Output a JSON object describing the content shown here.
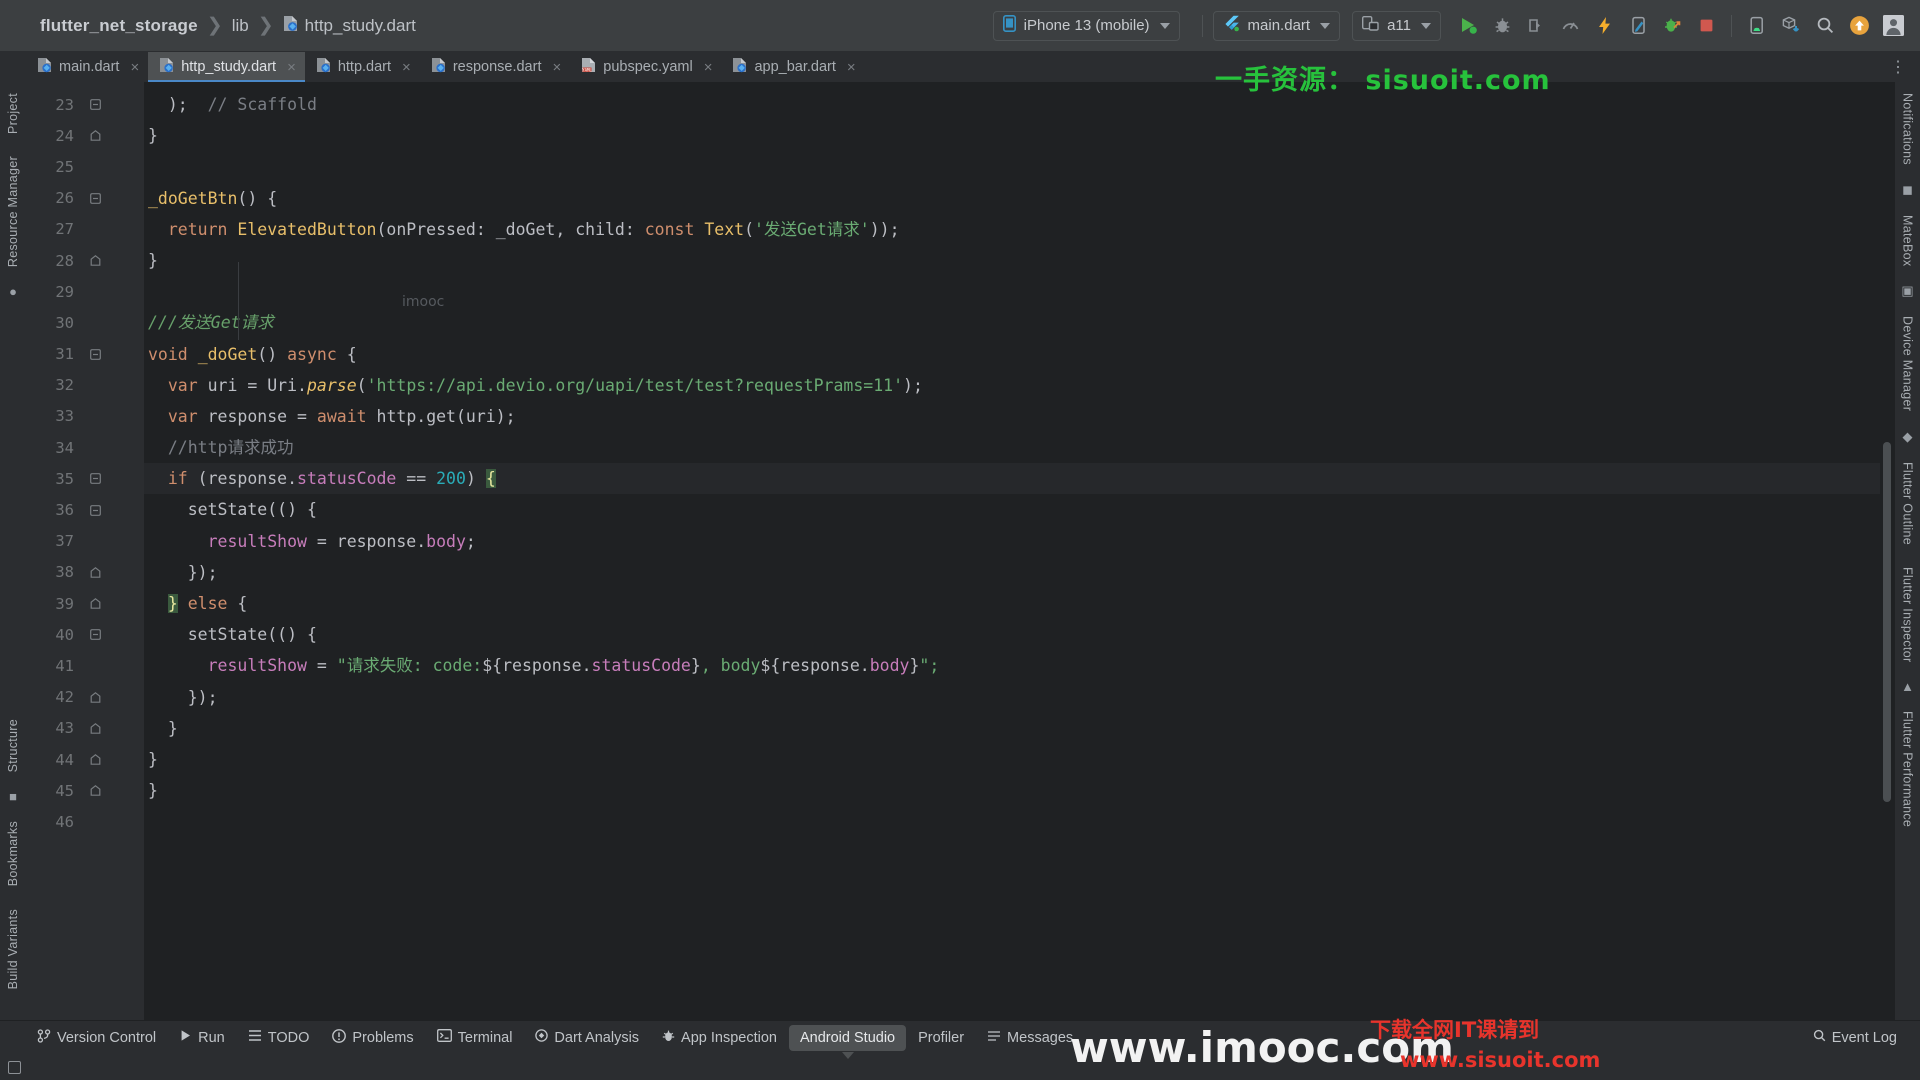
{
  "window": {
    "app": "Android Studio"
  },
  "breadcrumb": {
    "project": "flutter_net_storage",
    "folder": "lib",
    "file": "http_study.dart",
    "separator": "❯"
  },
  "toolbar": {
    "device_selector": "iPhone 13 (mobile)",
    "run_config": "main.dart",
    "emulator_target": "a11",
    "icons": [
      "run-icon",
      "debug-icon",
      "attach-debugger-icon",
      "profile-icon",
      "hot-reload-icon",
      "hot-restart-icon",
      "open-devtools-icon",
      "stop-icon"
    ],
    "right_icons": [
      "device-manager-icon",
      "sdk-download-icon",
      "search-icon",
      "update-icon",
      "avatar-icon"
    ]
  },
  "tabs": [
    {
      "label": "main.dart",
      "icon": "dart-file-icon",
      "active": false,
      "close": "×"
    },
    {
      "label": "http_study.dart",
      "icon": "dart-file-icon",
      "active": true,
      "close": "×"
    },
    {
      "label": "http.dart",
      "icon": "dart-file-icon",
      "active": false,
      "close": "×"
    },
    {
      "label": "response.dart",
      "icon": "dart-file-icon",
      "active": false,
      "close": "×"
    },
    {
      "label": "pubspec.yaml",
      "icon": "yaml-file-icon",
      "active": false,
      "close": "×"
    },
    {
      "label": "app_bar.dart",
      "icon": "dart-file-icon",
      "active": false,
      "close": "×"
    }
  ],
  "tabs_overflow_icon": "⋮",
  "left_tool_strip": [
    {
      "label": "Project",
      "name": "tool-project"
    },
    {
      "label": "Resource Manager",
      "name": "tool-resource-manager"
    },
    {
      "label": "Structure",
      "name": "tool-structure"
    },
    {
      "label": "Bookmarks",
      "name": "tool-bookmarks"
    },
    {
      "label": "Build Variants",
      "name": "tool-build-variants"
    }
  ],
  "right_tool_strip": [
    {
      "label": "Notifications",
      "name": "tool-notifications"
    },
    {
      "label": "MateBox",
      "name": "tool-matebox"
    },
    {
      "label": "Device Manager",
      "name": "tool-device-manager"
    },
    {
      "label": "Flutter Outline",
      "name": "tool-flutter-outline"
    },
    {
      "label": "Flutter Inspector",
      "name": "tool-flutter-inspector"
    },
    {
      "label": "Flutter Performance",
      "name": "tool-flutter-performance"
    }
  ],
  "editor": {
    "current_line": 35,
    "first_line": 23,
    "lines": [
      {
        "n": 23,
        "fold": "minus",
        "tokens": [
          {
            "t": "  );  ",
            "c": "punct"
          },
          {
            "t": "// Scaffold",
            "c": "cmt"
          }
        ]
      },
      {
        "n": 24,
        "fold": "end",
        "tokens": [
          {
            "t": "}",
            "c": "punct"
          }
        ]
      },
      {
        "n": 25,
        "fold": "",
        "tokens": [
          {
            "t": "",
            "c": "plain"
          }
        ]
      },
      {
        "n": 26,
        "fold": "minus",
        "tokens": [
          {
            "t": "_doGetBtn",
            "c": "fn"
          },
          {
            "t": "() {",
            "c": "punct"
          }
        ]
      },
      {
        "n": 27,
        "fold": "",
        "tokens": [
          {
            "t": "  ",
            "c": "plain"
          },
          {
            "t": "return",
            "c": "kw"
          },
          {
            "t": " ",
            "c": "plain"
          },
          {
            "t": "ElevatedButton",
            "c": "fn"
          },
          {
            "t": "(onPressed: ",
            "c": "punct"
          },
          {
            "t": "_doGet",
            "c": "plain"
          },
          {
            "t": ", child: ",
            "c": "punct"
          },
          {
            "t": "const",
            "c": "kw"
          },
          {
            "t": " ",
            "c": "plain"
          },
          {
            "t": "Text",
            "c": "fn"
          },
          {
            "t": "(",
            "c": "punct"
          },
          {
            "t": "'发送Get请求'",
            "c": "str"
          },
          {
            "t": "));",
            "c": "punct"
          }
        ]
      },
      {
        "n": 28,
        "fold": "end",
        "tokens": [
          {
            "t": "}",
            "c": "punct"
          }
        ]
      },
      {
        "n": 29,
        "fold": "",
        "tokens": [
          {
            "t": "",
            "c": "plain"
          }
        ]
      },
      {
        "n": 30,
        "fold": "",
        "tokens": [
          {
            "t": "///发送Get请求",
            "c": "cmt-doc"
          }
        ]
      },
      {
        "n": 31,
        "fold": "minus",
        "tokens": [
          {
            "t": "void",
            "c": "kw"
          },
          {
            "t": " ",
            "c": "plain"
          },
          {
            "t": "_doGet",
            "c": "fn"
          },
          {
            "t": "() ",
            "c": "punct"
          },
          {
            "t": "async",
            "c": "kw"
          },
          {
            "t": " {",
            "c": "punct"
          }
        ]
      },
      {
        "n": 32,
        "fold": "",
        "tokens": [
          {
            "t": "  ",
            "c": "plain"
          },
          {
            "t": "var",
            "c": "kw"
          },
          {
            "t": " uri = ",
            "c": "punct"
          },
          {
            "t": "Uri",
            "c": "plain"
          },
          {
            "t": ".",
            "c": "punct"
          },
          {
            "t": "parse",
            "c": "fn-i"
          },
          {
            "t": "(",
            "c": "punct"
          },
          {
            "t": "'https://api.devio.org/uapi/test/test?requestPrams=11'",
            "c": "str"
          },
          {
            "t": ");",
            "c": "punct"
          }
        ]
      },
      {
        "n": 33,
        "fold": "",
        "tokens": [
          {
            "t": "  ",
            "c": "plain"
          },
          {
            "t": "var",
            "c": "kw"
          },
          {
            "t": " response = ",
            "c": "punct"
          },
          {
            "t": "await",
            "c": "kw"
          },
          {
            "t": " http.",
            "c": "punct"
          },
          {
            "t": "get",
            "c": "plain"
          },
          {
            "t": "(uri);",
            "c": "punct"
          }
        ]
      },
      {
        "n": 34,
        "fold": "",
        "tokens": [
          {
            "t": "  ",
            "c": "plain"
          },
          {
            "t": "//http请求成功",
            "c": "cmt"
          }
        ]
      },
      {
        "n": 35,
        "fold": "minus",
        "current": true,
        "tokens": [
          {
            "t": "  ",
            "c": "plain"
          },
          {
            "t": "if",
            "c": "kw"
          },
          {
            "t": " (response.",
            "c": "punct"
          },
          {
            "t": "statusCode",
            "c": "fld"
          },
          {
            "t": " == ",
            "c": "punct"
          },
          {
            "t": "200",
            "c": "num"
          },
          {
            "t": ") ",
            "c": "punct"
          },
          {
            "t": "{",
            "c": "brmatch"
          }
        ]
      },
      {
        "n": 36,
        "fold": "minus",
        "tokens": [
          {
            "t": "    ",
            "c": "plain"
          },
          {
            "t": "setState",
            "c": "plain"
          },
          {
            "t": "(() {",
            "c": "punct"
          }
        ]
      },
      {
        "n": 37,
        "fold": "",
        "tokens": [
          {
            "t": "      ",
            "c": "plain"
          },
          {
            "t": "resultShow",
            "c": "fld"
          },
          {
            "t": " = response.",
            "c": "punct"
          },
          {
            "t": "body",
            "c": "fld"
          },
          {
            "t": ";",
            "c": "punct"
          }
        ]
      },
      {
        "n": 38,
        "fold": "end",
        "tokens": [
          {
            "t": "    });",
            "c": "punct"
          }
        ]
      },
      {
        "n": 39,
        "fold": "end",
        "tokens": [
          {
            "t": "  ",
            "c": "plain"
          },
          {
            "t": "}",
            "c": "brmatch"
          },
          {
            "t": " ",
            "c": "plain"
          },
          {
            "t": "else",
            "c": "kw"
          },
          {
            "t": " {",
            "c": "punct"
          }
        ]
      },
      {
        "n": 40,
        "fold": "minus",
        "tokens": [
          {
            "t": "    ",
            "c": "plain"
          },
          {
            "t": "setState",
            "c": "plain"
          },
          {
            "t": "(() {",
            "c": "punct"
          }
        ]
      },
      {
        "n": 41,
        "fold": "",
        "tokens": [
          {
            "t": "      ",
            "c": "plain"
          },
          {
            "t": "resultShow",
            "c": "fld"
          },
          {
            "t": " = ",
            "c": "punct"
          },
          {
            "t": "\"请求失败: code:",
            "c": "str"
          },
          {
            "t": "${response.",
            "c": "punct"
          },
          {
            "t": "statusCode",
            "c": "fld"
          },
          {
            "t": "}",
            "c": "punct"
          },
          {
            "t": ", body",
            "c": "str"
          },
          {
            "t": "${response.",
            "c": "punct"
          },
          {
            "t": "body",
            "c": "fld"
          },
          {
            "t": "}",
            "c": "punct"
          },
          {
            "t": "\";",
            "c": "str"
          }
        ]
      },
      {
        "n": 42,
        "fold": "end",
        "tokens": [
          {
            "t": "    });",
            "c": "punct"
          }
        ]
      },
      {
        "n": 43,
        "fold": "end",
        "tokens": [
          {
            "t": "  }",
            "c": "punct"
          }
        ]
      },
      {
        "n": 44,
        "fold": "end",
        "tokens": [
          {
            "t": "}",
            "c": "punct"
          }
        ]
      },
      {
        "n": 45,
        "fold": "end",
        "tokens": [
          {
            "t": "}",
            "c": "punct"
          }
        ]
      },
      {
        "n": 46,
        "fold": "",
        "tokens": [
          {
            "t": "",
            "c": "plain"
          }
        ]
      }
    ]
  },
  "bottom_bar": {
    "items": [
      {
        "label": "Version Control",
        "icon": "branch-icon",
        "name": "bottom-version-control"
      },
      {
        "label": "Run",
        "icon": "play-icon",
        "name": "bottom-run"
      },
      {
        "label": "TODO",
        "icon": "list-icon",
        "name": "bottom-todo"
      },
      {
        "label": "Problems",
        "icon": "warning-icon",
        "name": "bottom-problems"
      },
      {
        "label": "Terminal",
        "icon": "terminal-icon",
        "name": "bottom-terminal"
      },
      {
        "label": "Dart Analysis",
        "icon": "dart-icon",
        "name": "bottom-dart-analysis"
      },
      {
        "label": "App Inspection",
        "icon": "inspect-icon",
        "name": "bottom-app-inspection"
      },
      {
        "label": "Android Studio",
        "icon": "",
        "name": "bottom-android-studio",
        "pill": true
      },
      {
        "label": "Profiler",
        "icon": "",
        "name": "bottom-profiler"
      },
      {
        "label": "Messages",
        "icon": "message-icon",
        "name": "bottom-messages"
      }
    ],
    "event_log": "Event Log"
  },
  "watermarks": {
    "top_green": "一手资源： sisuoit.com",
    "editor_small": "imooc",
    "bottom_white": "www.imooc.com",
    "bottom_red_1": "下载全网IT课请到",
    "bottom_red_2": "www.sisuoit.com"
  },
  "colors": {
    "accent_blue": "#4a88c7",
    "green_watermark": "#27c23c",
    "red_watermark": "#e8342c",
    "editor_bg": "#1f2123",
    "chrome_bg": "#2b2d30"
  }
}
